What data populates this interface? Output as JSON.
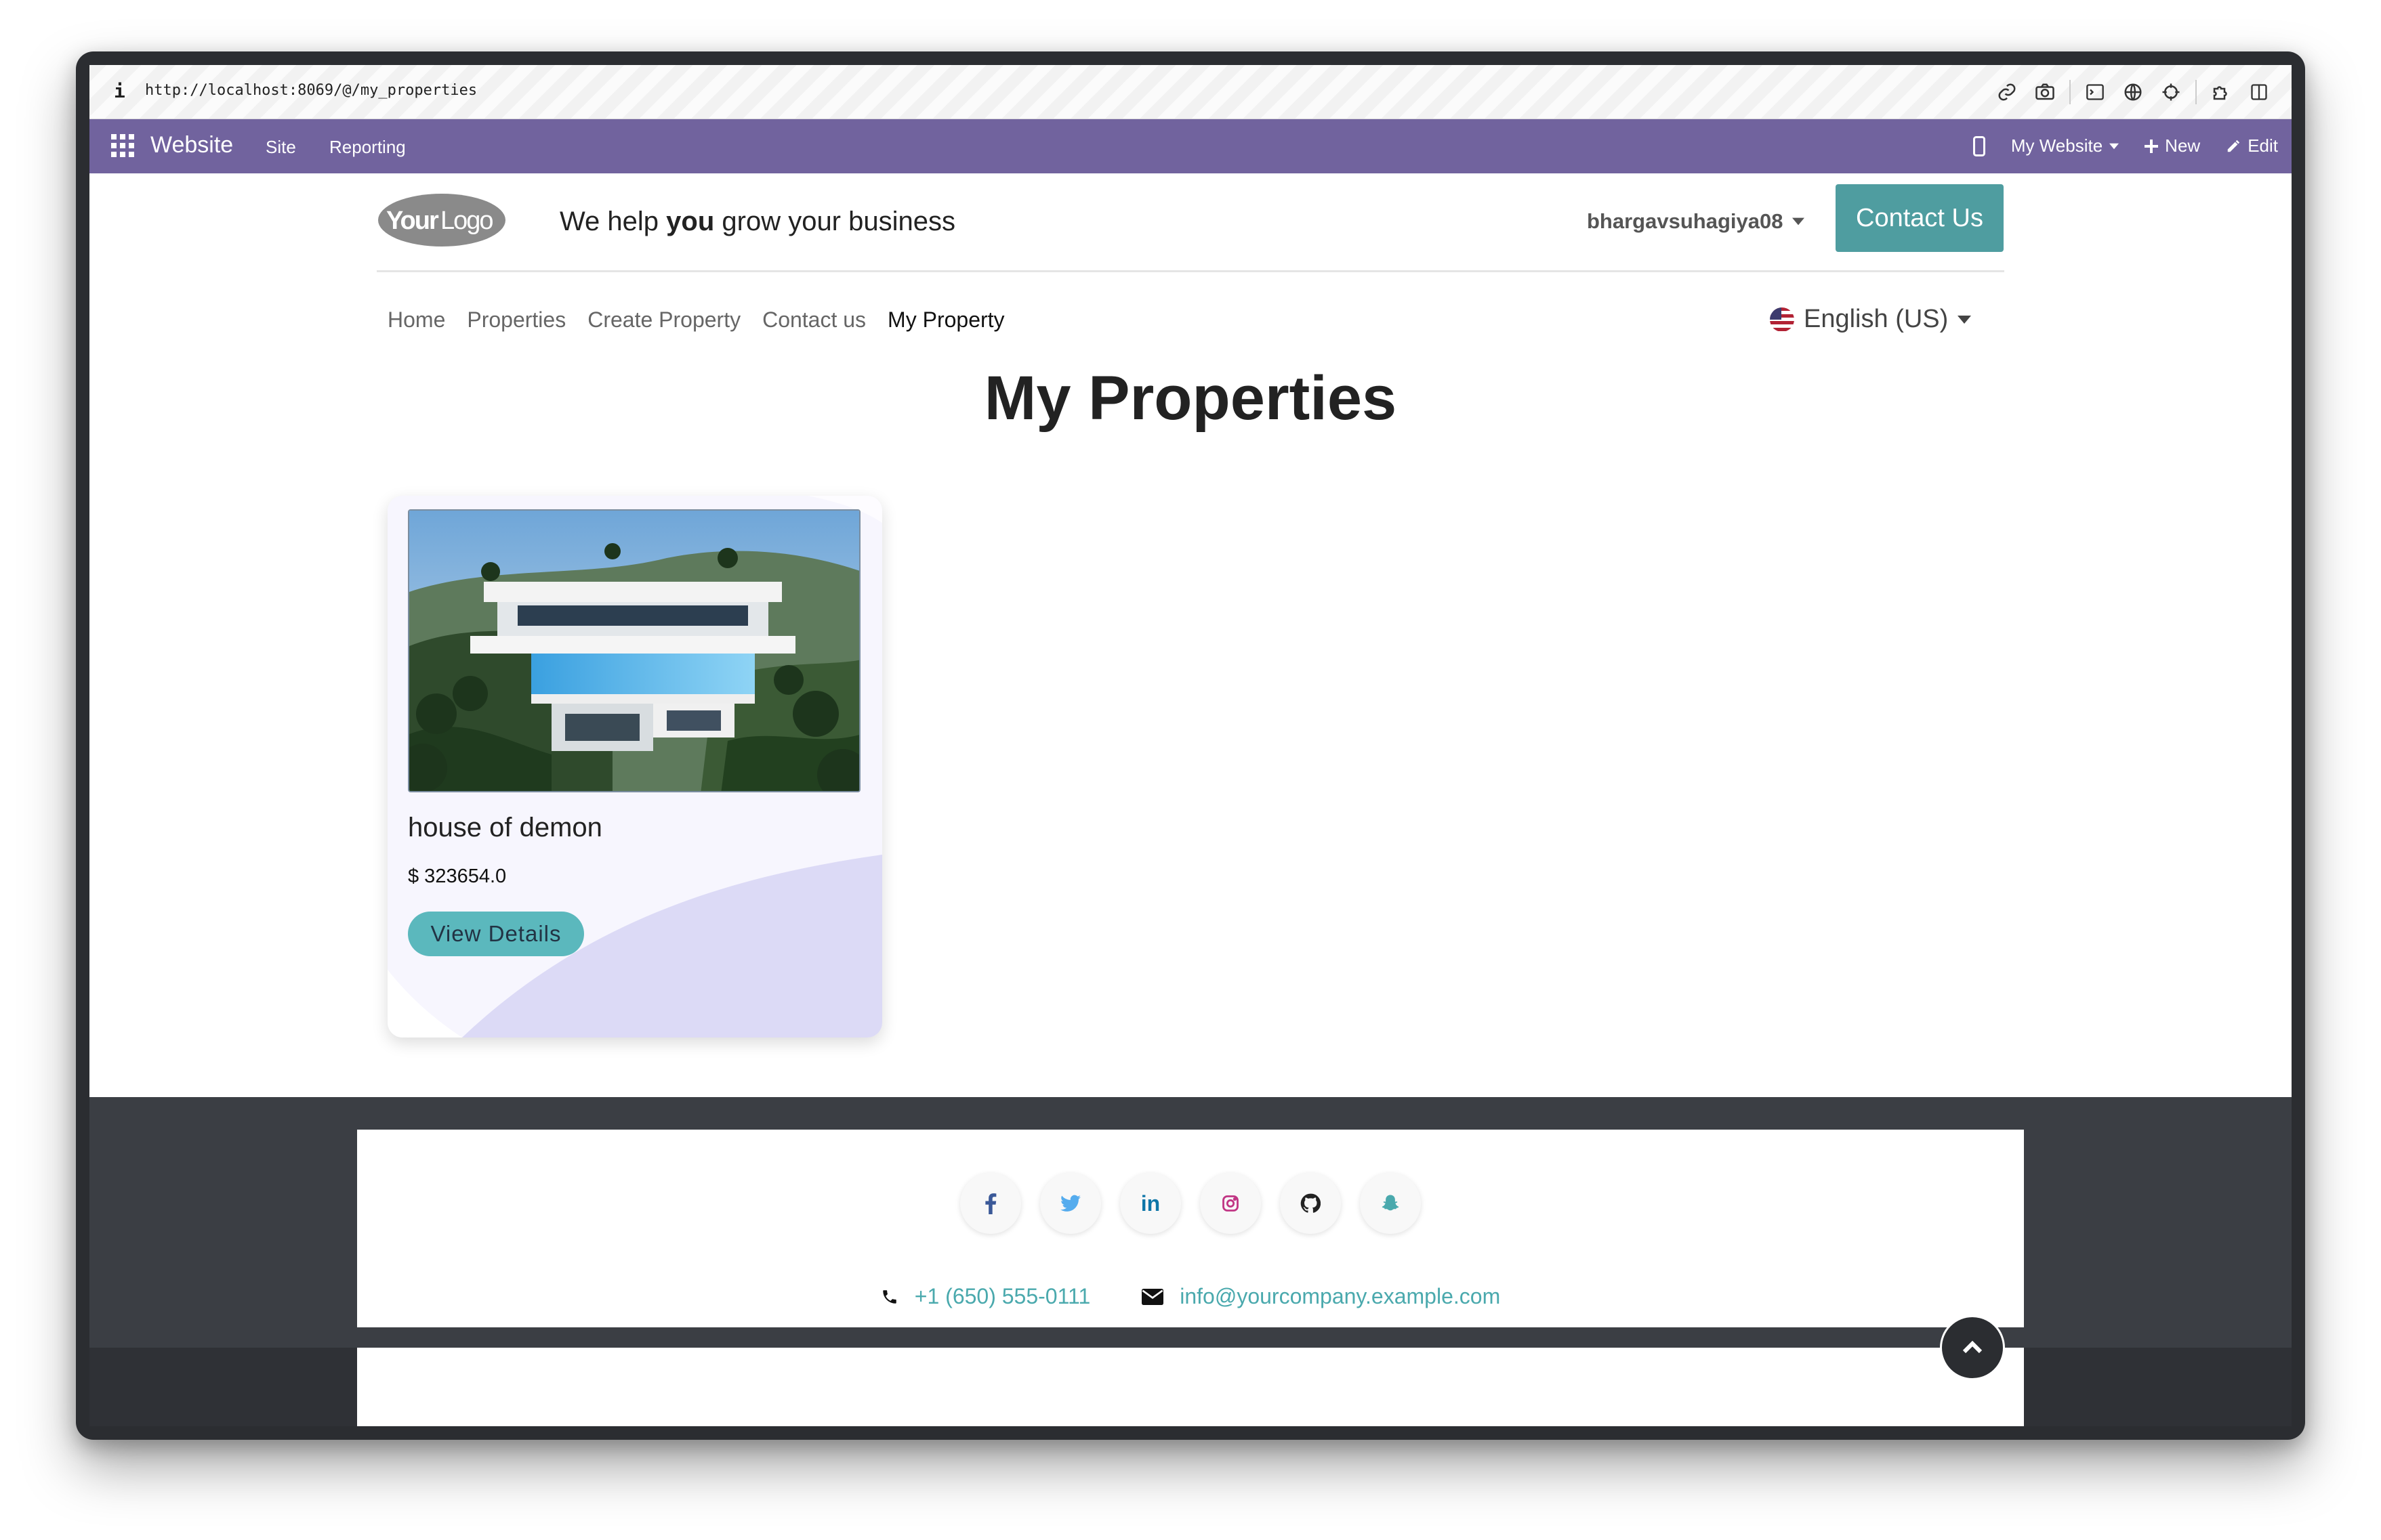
{
  "browser": {
    "info_label": "i",
    "url": "http://localhost:8069/@/my_properties"
  },
  "odoo_nav": {
    "app_name": "Website",
    "menu": [
      "Site",
      "Reporting"
    ],
    "website_selector": "My Website",
    "new_label": "New",
    "edit_label": "Edit",
    "color": "#71639e"
  },
  "header": {
    "logo_text": "YourLogo",
    "tagline_pre": "We help ",
    "tagline_bold": "you",
    "tagline_post": " grow your business",
    "user": "bhargavsuhagiya08",
    "contact_button": "Contact Us",
    "accent": "#4f9da0"
  },
  "site_nav": {
    "items": [
      "Home",
      "Properties",
      "Create Property",
      "Contact us",
      "My Property"
    ],
    "active": "My Property",
    "language": "English (US)"
  },
  "page": {
    "title": "My Properties"
  },
  "properties": [
    {
      "name": "house of demon",
      "price": "$ 323654.0",
      "button": "View Details"
    }
  ],
  "footer": {
    "socials": [
      "facebook-icon",
      "twitter-icon",
      "linkedin-icon",
      "instagram-icon",
      "github-icon",
      "snapchat-icon"
    ],
    "phone": "+1 (650) 555-0111",
    "email": "info@yourcompany.example.com"
  }
}
